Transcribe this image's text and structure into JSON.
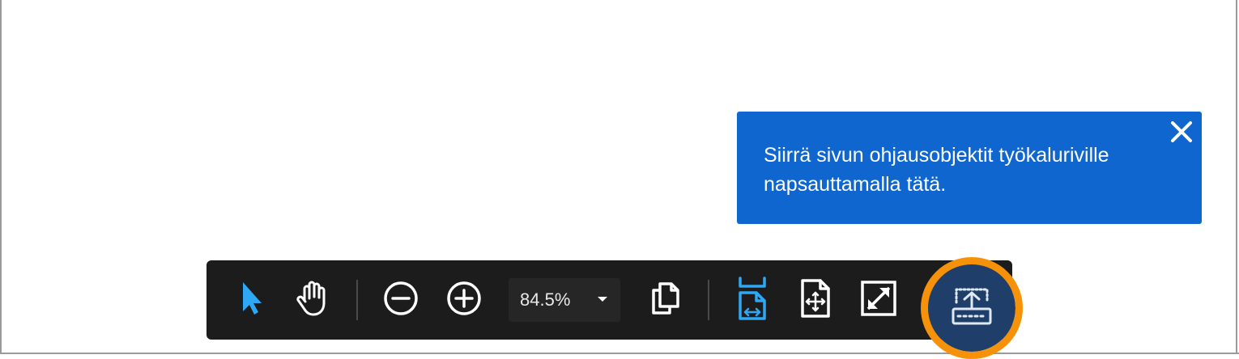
{
  "tooltip": {
    "message": "Siirrä sivun ohjausobjektit työkaluriville napsauttamalla tätä.",
    "close_icon": "close-icon"
  },
  "toolbar": {
    "zoom_value": "84.5%",
    "tools": [
      {
        "name": "select-tool",
        "icon": "arrow-pointer-icon"
      },
      {
        "name": "hand-tool",
        "icon": "hand-icon"
      },
      {
        "name": "zoom-out",
        "icon": "minus-circle-icon"
      },
      {
        "name": "zoom-in",
        "icon": "plus-circle-icon"
      },
      {
        "name": "page-view",
        "icon": "pages-icon"
      },
      {
        "name": "fit-width",
        "icon": "fit-width-icon"
      },
      {
        "name": "fit-page",
        "icon": "fit-page-icon"
      },
      {
        "name": "full-screen",
        "icon": "expand-icon"
      },
      {
        "name": "dock-page-controls",
        "icon": "dock-up-icon"
      }
    ]
  },
  "colors": {
    "tooltip_bg": "#0f66cf",
    "toolbar_bg": "#1c1c1c",
    "accent_blue": "#2ea8f5",
    "highlight_ring": "#f5920a",
    "dock_button_bg": "#1f3f6a"
  }
}
